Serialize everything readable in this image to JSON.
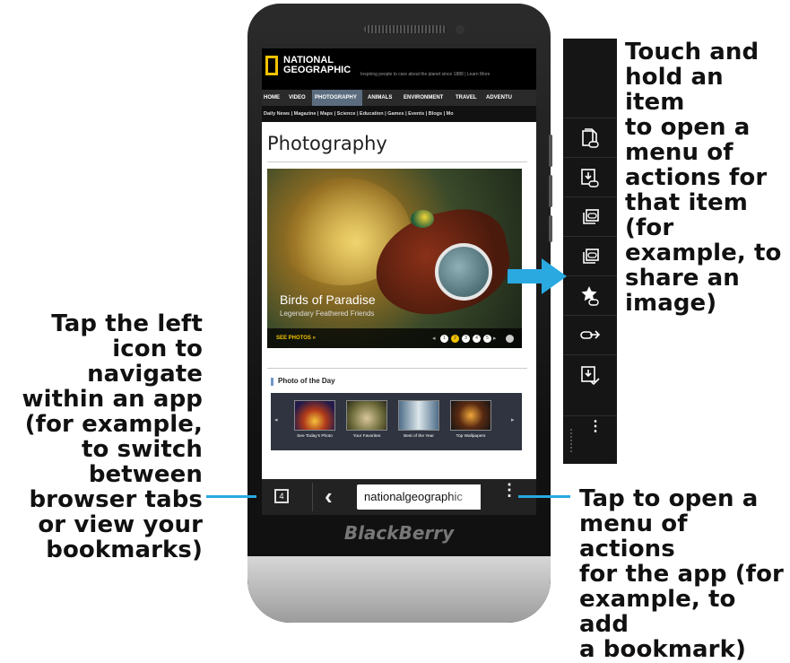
{
  "callouts": {
    "right": "Touch and\nhold an item\nto open a\nmenu of\nactions for\nthat item (for\nexample, to\nshare an\nimage)",
    "left": "Tap the left\nicon to navigate\nwithin an app\n(for example,\nto switch\nbetween\nbrowser tabs\nor view your\nbookmarks)",
    "bottom": "Tap to open a\nmenu of actions\nfor the app (for\nexample, to add\na bookmark)"
  },
  "device": {
    "brand_logo": "BlackBerry"
  },
  "site": {
    "logo_text": "NATIONAL\nGEOGRAPHIC",
    "tagline": "Inspiring people to care about the planet since 1888  |  Learn More",
    "nav": [
      "HOME",
      "VIDEO",
      "PHOTOGRAPHY",
      "ANIMALS",
      "ENVIRONMENT",
      "TRAVEL",
      "ADVENTU"
    ],
    "subnav": "Daily News  |  Magazine  |  Maps  |  Science  |  Education  |  Games  |  Events  |  Blogs  |  Mo",
    "page_title": "Photography",
    "hero": {
      "title": "Birds of Paradise",
      "subtitle": "Legendary Feathered Friends",
      "cta": "SEE PHOTOS »",
      "pager": [
        "1",
        "2",
        "3",
        "4",
        "5"
      ],
      "pager_active": 2
    },
    "photo_of_day": {
      "heading": "Photo of the Day",
      "thumbs": [
        "See Today's Photo",
        "Your Favorites",
        "Best of the Year",
        "Top Wallpapers"
      ],
      "prev": "◂",
      "next": "▸"
    }
  },
  "browser_bar": {
    "tab_count": "4",
    "back_icon": "‹",
    "url": "nationalgeographic",
    "menu_icon": "⋮"
  },
  "action_bar": {
    "items": [
      "share-link-icon",
      "download-link-icon",
      "copy-link-icon",
      "copy-image-icon",
      "bookmark-link-icon",
      "send-link-icon",
      "save-image-icon"
    ],
    "more_icon": "⋮"
  },
  "colors": {
    "accent_blue": "#29a9e0",
    "ng_yellow": "#f2c200"
  }
}
